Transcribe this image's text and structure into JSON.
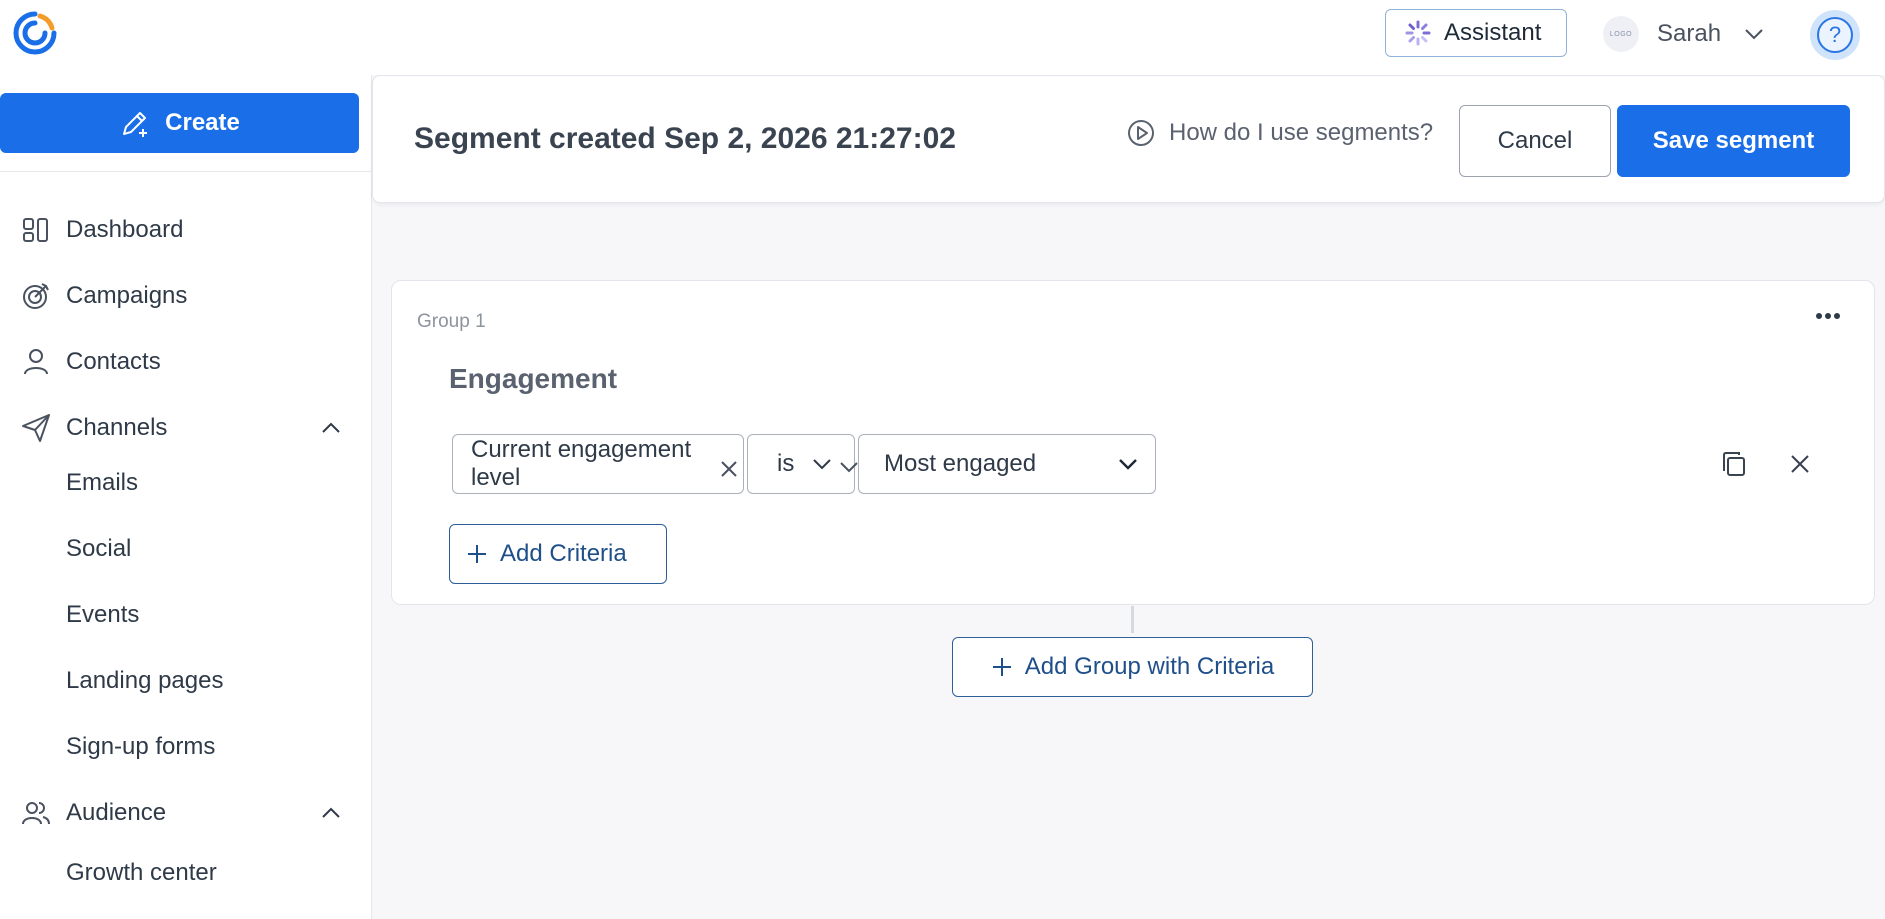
{
  "topbar": {
    "assistant_label": "Assistant",
    "avatar_text": "LOGO",
    "user_name": "Sarah"
  },
  "sidebar": {
    "create_label": "Create",
    "items": [
      {
        "label": "Dashboard",
        "icon": "dashboard-icon"
      },
      {
        "label": "Campaigns",
        "icon": "campaigns-icon"
      },
      {
        "label": "Contacts",
        "icon": "contacts-icon"
      },
      {
        "label": "Channels",
        "icon": "channels-icon",
        "expanded": true
      },
      {
        "label": "Audience",
        "icon": "audience-icon",
        "expanded": true
      }
    ],
    "channels_sub": [
      "Emails",
      "Social",
      "Events",
      "Landing pages",
      "Sign-up forms"
    ],
    "audience_sub": [
      "Growth center"
    ]
  },
  "header": {
    "title": "Segment created Sep 2, 2026 21:27:02",
    "help_link": "How do I use segments?",
    "cancel_label": "Cancel",
    "save_label": "Save segment"
  },
  "group": {
    "label": "Group 1",
    "title": "Engagement",
    "criteria": {
      "field": "Current engagement level",
      "operator": "is",
      "value": "Most engaged"
    },
    "add_criteria_label": "Add Criteria"
  },
  "add_group_label": "Add Group with Criteria",
  "colors": {
    "primary": "#1a6fe8",
    "outline_blue": "#1f4f8a",
    "background": "#f7f7f9"
  }
}
